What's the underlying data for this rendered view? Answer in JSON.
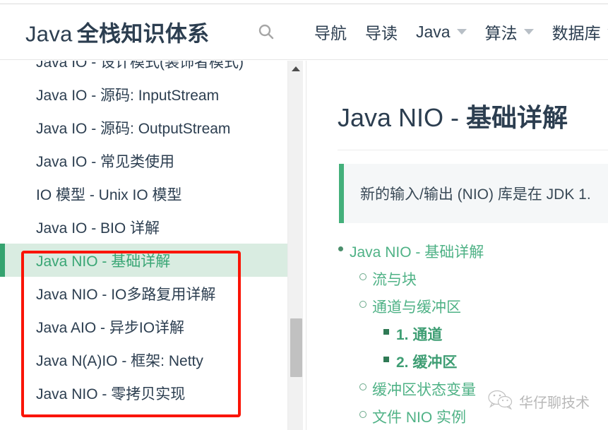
{
  "header": {
    "brand_latin": "Java",
    "brand_cjk": "全栈知识体系",
    "search_icon": "search-icon",
    "nav": [
      {
        "label": "导航",
        "has_caret": false
      },
      {
        "label": "导读",
        "has_caret": false
      },
      {
        "label": "Java",
        "has_caret": true
      },
      {
        "label": "算法",
        "has_caret": true
      },
      {
        "label": "数据库",
        "has_caret": true
      }
    ]
  },
  "sidebar": {
    "items": [
      {
        "label": "Java IO - 设计模式(装饰者模式)",
        "active": false
      },
      {
        "label": "Java IO - 源码: InputStream",
        "active": false
      },
      {
        "label": "Java IO - 源码: OutputStream",
        "active": false
      },
      {
        "label": "Java IO - 常见类使用",
        "active": false
      },
      {
        "label": "IO 模型 - Unix IO 模型",
        "active": false
      },
      {
        "label": "Java IO - BIO 详解",
        "active": false
      },
      {
        "label": "Java NIO - 基础详解",
        "active": true
      },
      {
        "label": "Java NIO - IO多路复用详解",
        "active": false
      },
      {
        "label": "Java AIO - 异步IO详解",
        "active": false
      },
      {
        "label": "Java N(A)IO - 框架: Netty",
        "active": false
      },
      {
        "label": "Java NIO - 零拷贝实现",
        "active": false
      }
    ],
    "scrollbar": {
      "up_arrow_icon": "chevron-up-icon"
    }
  },
  "content": {
    "title_latin": "Java NIO - ",
    "title_cjk": "基础详解",
    "blockquote": "新的输入/输出 (NIO) 库是在 JDK 1.",
    "toc": [
      {
        "level": 1,
        "bullet": "disc",
        "label": "Java NIO - 基础详解",
        "strong": false
      },
      {
        "level": 2,
        "bullet": "circle",
        "label": "流与块",
        "strong": false
      },
      {
        "level": 2,
        "bullet": "circle",
        "label": "通道与缓冲区",
        "strong": false
      },
      {
        "level": 3,
        "bullet": "square",
        "label": "1. 通道",
        "strong": true
      },
      {
        "level": 3,
        "bullet": "square",
        "label": "2. 缓冲区",
        "strong": true
      },
      {
        "level": 2,
        "bullet": "circle",
        "label": "缓冲区状态变量",
        "strong": false
      },
      {
        "level": 2,
        "bullet": "circle",
        "label": "文件 NIO 实例",
        "strong": false
      }
    ]
  },
  "annotation": {
    "red_box_color": "#fa1405"
  },
  "watermark": {
    "icon": "wechat-icon",
    "text": "华仔聊技术"
  },
  "colors": {
    "accent_green": "#3aa675",
    "active_bg": "#d9ece1",
    "link_green": "#4fb286",
    "text_dark": "#2c3e50",
    "scrollbar_thumb": "#c1c1c1"
  }
}
